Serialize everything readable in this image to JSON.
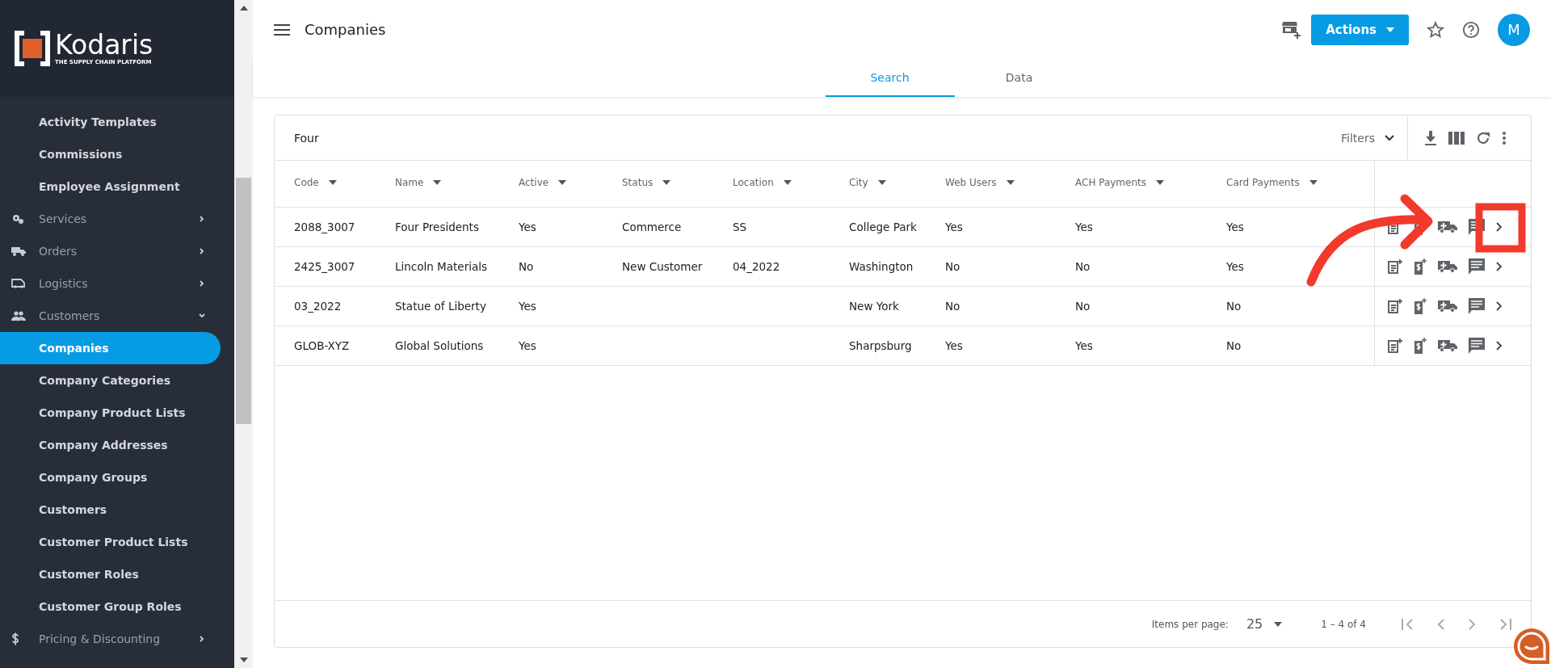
{
  "sidebar": {
    "logo": {
      "name": "Kodaris",
      "tagline": "THE SUPPLY CHAIN PLATFORM"
    },
    "items": [
      {
        "label": "Activity Templates",
        "kind": "sub",
        "selected": false
      },
      {
        "label": "Commissions",
        "kind": "sub",
        "selected": false
      },
      {
        "label": "Employee Assignment",
        "kind": "sub",
        "selected": false
      },
      {
        "label": "Services",
        "kind": "group",
        "expanded": false,
        "selected": false
      },
      {
        "label": "Orders",
        "kind": "group",
        "expanded": false,
        "selected": false
      },
      {
        "label": "Logistics",
        "kind": "group",
        "expanded": false,
        "selected": false
      },
      {
        "label": "Customers",
        "kind": "group",
        "expanded": true,
        "selected": false
      },
      {
        "label": "Companies",
        "kind": "sub",
        "selected": true
      },
      {
        "label": "Company Categories",
        "kind": "sub",
        "selected": false
      },
      {
        "label": "Company Product Lists",
        "kind": "sub",
        "selected": false
      },
      {
        "label": "Company Addresses",
        "kind": "sub",
        "selected": false
      },
      {
        "label": "Company Groups",
        "kind": "sub",
        "selected": false
      },
      {
        "label": "Customers",
        "kind": "sub",
        "selected": false
      },
      {
        "label": "Customer Product Lists",
        "kind": "sub",
        "selected": false
      },
      {
        "label": "Customer Roles",
        "kind": "sub",
        "selected": false
      },
      {
        "label": "Customer Group Roles",
        "kind": "sub",
        "selected": false
      },
      {
        "label": "Pricing & Discounting",
        "kind": "group",
        "expanded": false,
        "selected": false
      }
    ]
  },
  "header": {
    "title": "Companies",
    "actions_button": "Actions",
    "avatar": "M"
  },
  "tabs": [
    {
      "label": "Search",
      "selected": true
    },
    {
      "label": "Data",
      "selected": false
    }
  ],
  "table": {
    "search_value": "Four",
    "filters_label": "Filters",
    "columns": [
      "Code",
      "Name",
      "Active",
      "Status",
      "Location",
      "City",
      "Web Users",
      "ACH Payments",
      "Card Payments"
    ],
    "rows": [
      {
        "cells": [
          "2088_3007",
          "Four Presidents",
          "Yes",
          "Commerce",
          "SS",
          "College Park",
          "Yes",
          "Yes",
          "Yes"
        ]
      },
      {
        "cells": [
          "2425_3007",
          "Lincoln Materials",
          "No",
          "New Customer",
          "04_2022",
          "Washington",
          "No",
          "No",
          "Yes"
        ]
      },
      {
        "cells": [
          "03_2022",
          "Statue of Liberty",
          "Yes",
          "",
          "",
          "New York",
          "No",
          "No",
          "No"
        ]
      },
      {
        "cells": [
          "GLOB-XYZ",
          "Global Solutions",
          "Yes",
          "",
          "",
          "Sharpsburg",
          "Yes",
          "Yes",
          "No"
        ]
      }
    ],
    "pagination": {
      "items_per_page_label": "Items per page:",
      "page_size": "25",
      "range": "1 – 4 of 4"
    }
  }
}
